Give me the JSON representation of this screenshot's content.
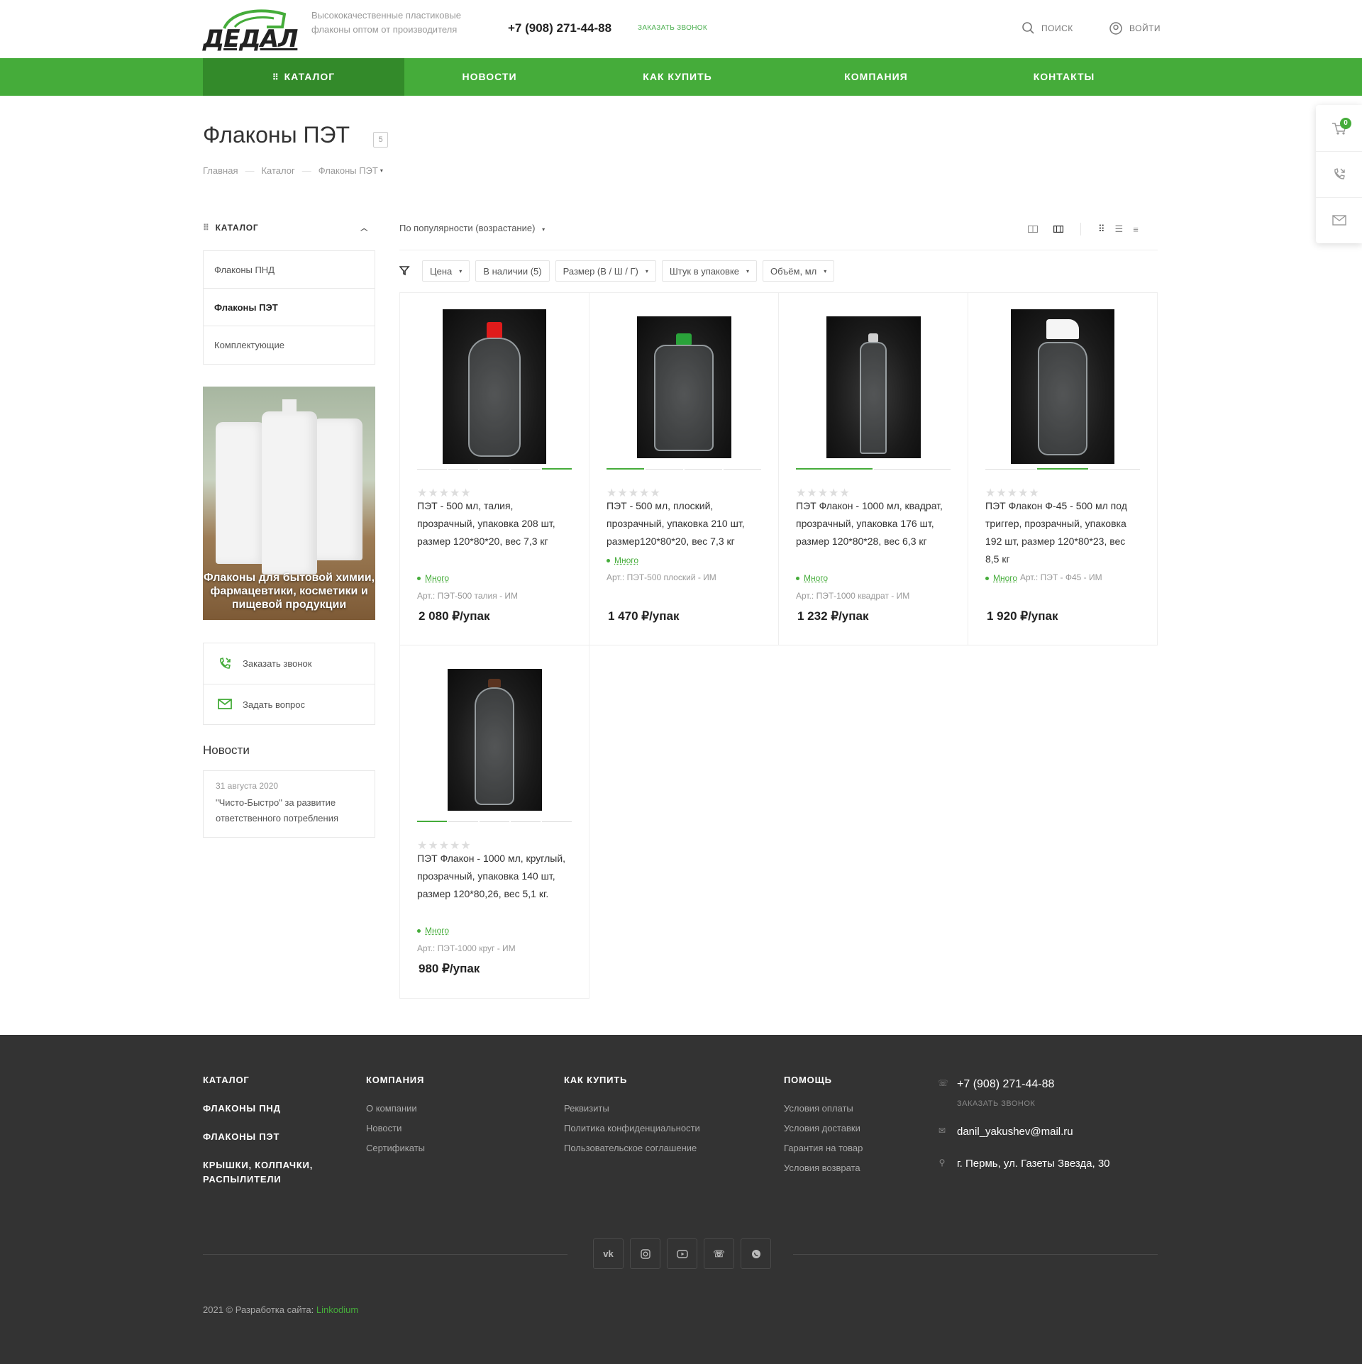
{
  "header": {
    "logo_text": "ДЕДАЛ",
    "tagline": "Высококачественные пластиковые флаконы оптом от производителя",
    "phone": "+7 (908) 271-44-88",
    "callback": "ЗАКАЗАТЬ ЗВОНОК",
    "search": "ПОИСК",
    "login": "ВОЙТИ"
  },
  "nav": {
    "catalog": "КАТАЛОГ",
    "items": [
      "НОВОСТИ",
      "КАК КУПИТЬ",
      "КОМПАНИЯ",
      "КОНТАКТЫ"
    ]
  },
  "float": {
    "cart_count": "0"
  },
  "page": {
    "title": "Флаконы ПЭТ",
    "count": "5",
    "breadcrumb": [
      "Главная",
      "Каталог",
      "Флаконы ПЭТ"
    ]
  },
  "sidebar": {
    "catalog_head": "КАТАЛОГ",
    "items": [
      "Флаконы ПНД",
      "Флаконы ПЭТ",
      "Комплектующие"
    ],
    "promo_text": "Флаконы для бытовой химии, фармацевтики, косметики и пищевой продукции",
    "actions": [
      "Заказать звонок",
      "Задать вопрос"
    ],
    "news_head": "Новости",
    "news": {
      "date": "31 августа 2020",
      "text": "\"Чисто-Быстро\" за развитие ответственного потребления"
    }
  },
  "toolbar": {
    "sort": "По популярности (возрастание)",
    "filters": [
      "Цена",
      "В наличии (5)",
      "Размер (В / Ш / Г)",
      "Штук в упаковке",
      "Объём, мл"
    ]
  },
  "products": [
    {
      "name": "ПЭТ - 500 мл, талия, прозрачный, упаковка 208 шт, размер 120*80*20, вес 7,3 кг",
      "stock": "Много",
      "art": "Арт.: ПЭТ-500 талия - ИМ",
      "price": "2 080 ₽/упак",
      "cap_color": "#e01b1b"
    },
    {
      "name": "ПЭТ - 500 мл, плоский, прозрачный, упаковка 210 шт, размер120*80*20, вес 7,3 кг",
      "stock": "Много",
      "art": "Арт.: ПЭТ-500 плоский - ИМ",
      "price": "1 470 ₽/упак",
      "cap_color": "#2aa33a"
    },
    {
      "name": "ПЭТ Флакон - 1000 мл, квадрат, прозрачный, упаковка 176 шт, размер 120*80*28, вес 6,3 кг",
      "stock": "Много",
      "art": "Арт.: ПЭТ-1000 квадрат - ИМ",
      "price": "1 232 ₽/упак",
      "cap_color": "#cfcfcf"
    },
    {
      "name": "ПЭТ Флакон Ф-45 - 500 мл под триггер, прозрачный, упаковка 192 шт, размер 120*80*23, вес 8,5 кг",
      "stock": "Много",
      "art": "Арт.: ПЭТ - Ф45 - ИМ",
      "price": "1 920 ₽/упак",
      "cap_color": "#f5f5f5"
    },
    {
      "name": "ПЭТ Флакон - 1000 мл, круглый, прозрачный, упаковка 140 шт, размер 120*80,26, вес 5,1 кг.",
      "stock": "Много",
      "art": "Арт.: ПЭТ-1000 круг - ИМ",
      "price": "980 ₽/упак",
      "cap_color": "#5a3320"
    }
  ],
  "footer": {
    "col1_head": "КАТАЛОГ",
    "col1_items": [
      "ФЛАКОНЫ ПНД",
      "ФЛАКОНЫ ПЭТ",
      "КРЫШКИ, КОЛПАЧКИ, РАСПЫЛИТЕЛИ"
    ],
    "col2_head": "КОМПАНИЯ",
    "col2_items": [
      "О компании",
      "Новости",
      "Сертификаты"
    ],
    "col3_head": "КАК КУПИТЬ",
    "col3_items": [
      "Реквизиты",
      "Политика конфиденциальности",
      "Пользовательское соглашение"
    ],
    "col4_head": "ПОМОЩЬ",
    "col4_items": [
      "Условия оплаты",
      "Условия доставки",
      "Гарантия на товар",
      "Условия возврата"
    ],
    "phone": "+7 (908) 271-44-88",
    "callback": "ЗАКАЗАТЬ ЗВОНОК",
    "email": "danil_yakushev@mail.ru",
    "address": "г. Пермь, ул. Газеты Звезда, 30",
    "social": [
      "vk-icon",
      "instagram-icon",
      "youtube-icon",
      "viber-icon",
      "whatsapp-icon"
    ],
    "copyright": "2021 © Разработка сайта:",
    "developer": "Linkodium"
  },
  "colors": {
    "brand": "#45ac3a",
    "brand_dark": "#338a2a",
    "footer_bg": "#333333"
  }
}
